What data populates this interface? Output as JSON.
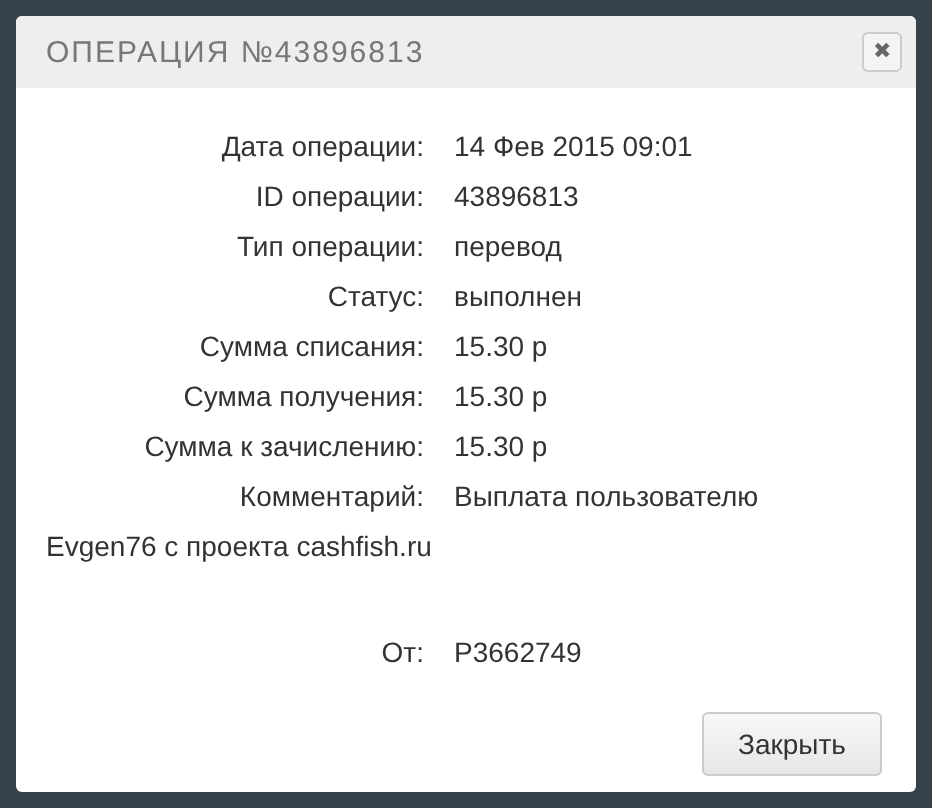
{
  "dialog": {
    "title": "ОПЕРАЦИЯ №43896813",
    "close_icon": "✖",
    "fields": [
      {
        "label": "Дата операции:",
        "value": "14 Фев 2015 09:01"
      },
      {
        "label": "ID операции:",
        "value": "43896813"
      },
      {
        "label": "Тип операции:",
        "value": "перевод"
      },
      {
        "label": "Статус:",
        "value": "выполнен"
      },
      {
        "label": "Сумма списания:",
        "value": "15.30 р"
      },
      {
        "label": "Сумма получения:",
        "value": "15.30 р"
      },
      {
        "label": "Сумма к зачислению:",
        "value": "15.30 р"
      }
    ],
    "comment": {
      "label": "Комментарий:",
      "lines": [
        "Выплата пользователю",
        "Evgen76 с проекта cashfish.ru"
      ]
    },
    "from": {
      "label": "От:",
      "value": "P3662749"
    },
    "buttons": [
      "Закрыть"
    ]
  }
}
